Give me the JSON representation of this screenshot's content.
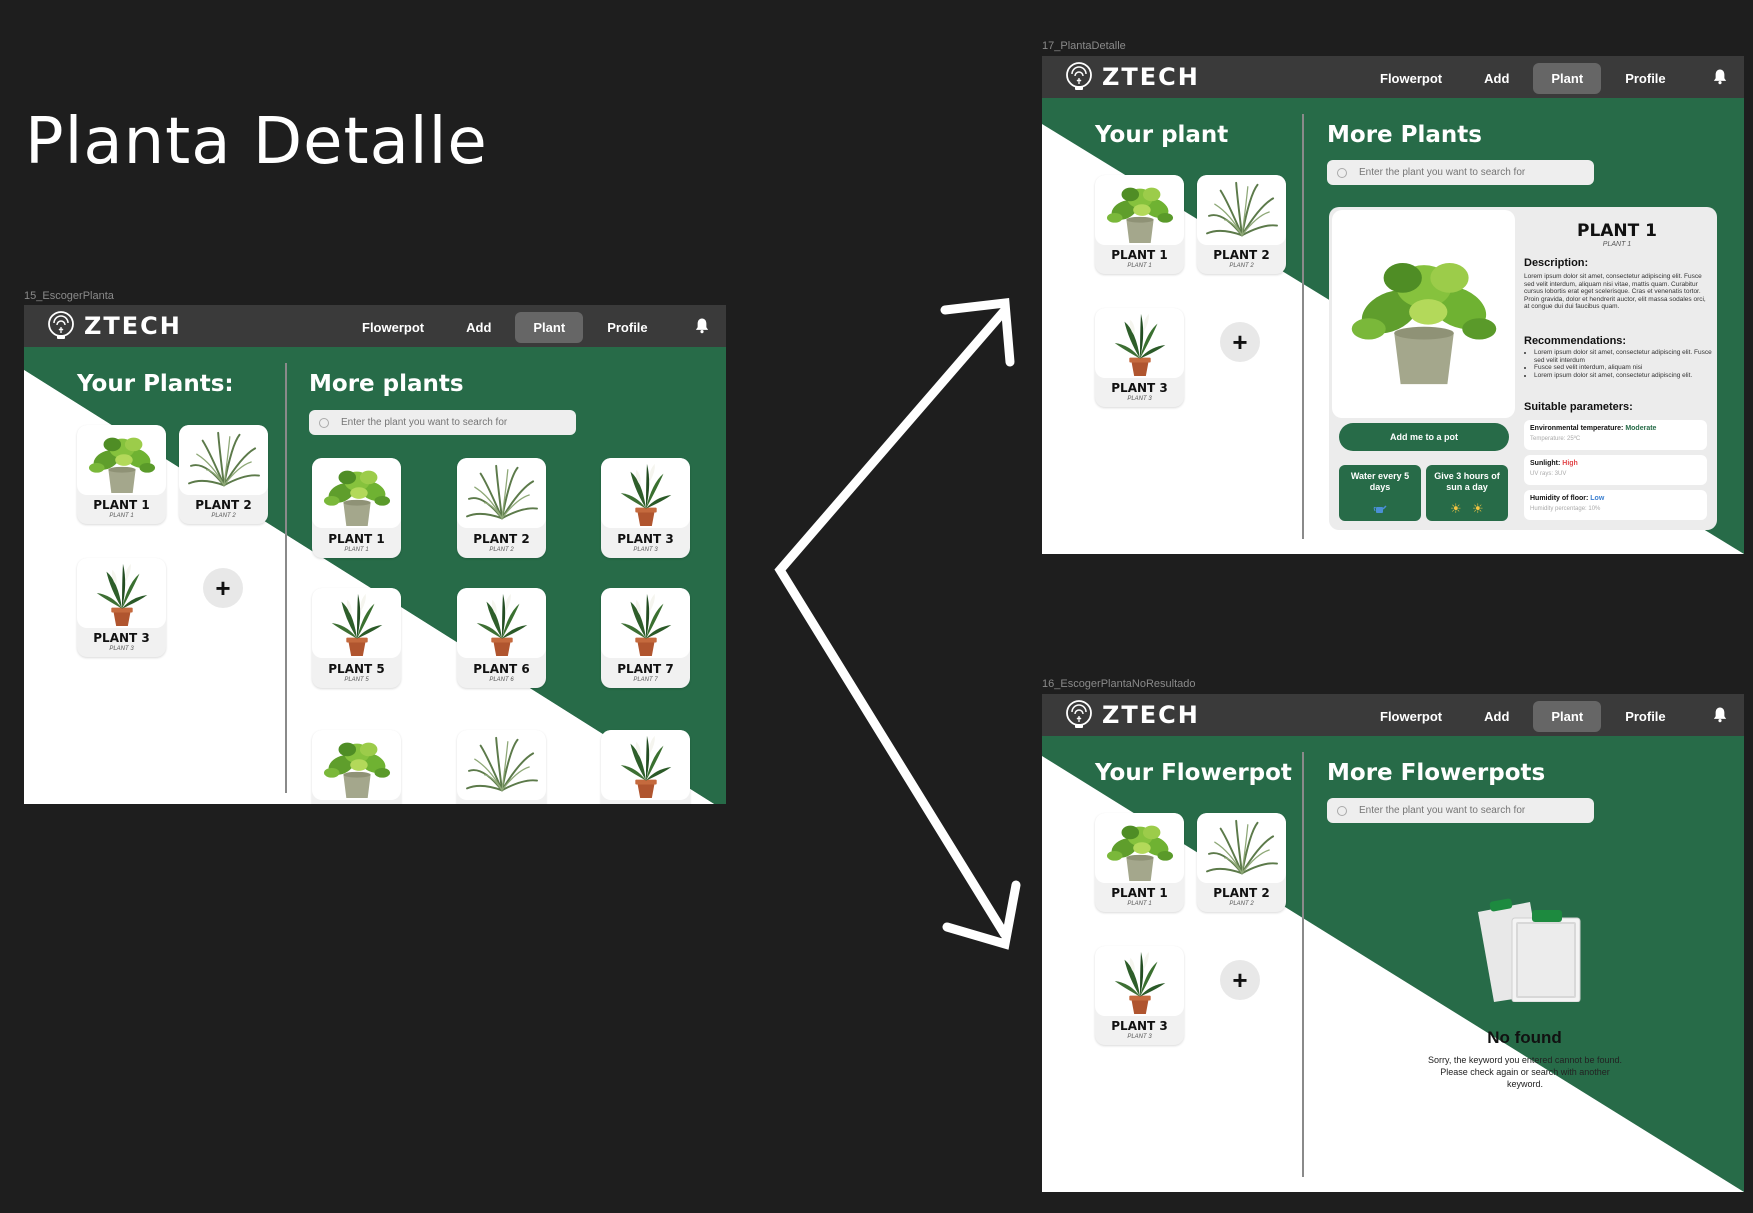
{
  "page_title": "Planta Detalle",
  "nav": {
    "brand": "ZTECH",
    "links": [
      "Flowerpot",
      "Add",
      "Plant",
      "Profile"
    ],
    "active": "Plant"
  },
  "search_placeholder": "Enter the plant you want to search for",
  "colors": {
    "green": "#276b48",
    "dark": "#1e1e1e",
    "nav": "#3a3a3a"
  },
  "frame1": {
    "label": "15_EscogerPlanta",
    "your_title": "Your Plants:",
    "more_title": "More plants",
    "your_plants": [
      {
        "name": "PLANT 1",
        "sub": "PLANT 1"
      },
      {
        "name": "PLANT 2",
        "sub": "PLANT 2"
      },
      {
        "name": "PLANT 3",
        "sub": "PLANT 3"
      }
    ],
    "more_plants": [
      {
        "name": "PLANT 1",
        "sub": "PLANT 1"
      },
      {
        "name": "PLANT 2",
        "sub": "PLANT 2"
      },
      {
        "name": "PLANT 3",
        "sub": "PLANT 3"
      },
      {
        "name": "PLANT 5",
        "sub": "PLANT 5"
      },
      {
        "name": "PLANT 6",
        "sub": "PLANT 6"
      },
      {
        "name": "PLANT 7",
        "sub": "PLANT 7"
      }
    ]
  },
  "frame2": {
    "label": "17_PlantaDetalle",
    "your_title": "Your plant",
    "more_title": "More Plants",
    "your_plants": [
      {
        "name": "PLANT 1",
        "sub": "PLANT 1"
      },
      {
        "name": "PLANT 2",
        "sub": "PLANT 2"
      },
      {
        "name": "PLANT 3",
        "sub": "PLANT 3"
      }
    ],
    "detail": {
      "name": "PLANT 1",
      "sub": "PLANT 1",
      "description_title": "Description:",
      "description": "Lorem ipsum dolor sit amet, consectetur adipiscing elit. Fusce sed velit interdum, aliquam nisi vitae, mattis quam. Curabitur cursus lobortis erat eget scelerisque. Cras et venenatis tortor. Proin gravida, dolor et hendrerit auctor, elit massa sodales orci, at congue dui dui faucibus quam.",
      "recommendations_title": "Recommendations:",
      "recommendations": [
        "Lorem ipsum dolor sit amet, consectetur adipiscing elit. Fusce sed velit interdum",
        "Fusce sed velit interdum, aliquam nisi",
        "Lorem ipsum dolor sit amet, consectetur adipiscing elit."
      ],
      "params_title": "Suitable parameters:",
      "params": [
        {
          "label": "Environmental temperature:",
          "value": "Moderate",
          "color": "#276b48",
          "sub": "Temperature: 25ºC"
        },
        {
          "label": "Sunlight:",
          "value": "High",
          "color": "#e2474b",
          "sub": "UV rays: 3UV"
        },
        {
          "label": "Humidity of floor:",
          "value": "Low",
          "color": "#3b7fd0",
          "sub": "Humidity percentage: 10%"
        }
      ],
      "add_button": "Add me to a pot",
      "water_label": "Water every 5 days",
      "sun_label": "Give 3 hours of sun a day"
    }
  },
  "frame3": {
    "label": "16_EscogerPlantaNoResultado",
    "your_title": "Your Flowerpot",
    "more_title": "More Flowerpots",
    "your_plants": [
      {
        "name": "PLANT 1",
        "sub": "PLANT 1"
      },
      {
        "name": "PLANT 2",
        "sub": "PLANT 2"
      },
      {
        "name": "PLANT 3",
        "sub": "PLANT 3"
      }
    ],
    "not_found_title": "No found",
    "not_found_text": "Sorry, the keyword you entered cannot be found. Please check again or search with another keyword."
  }
}
